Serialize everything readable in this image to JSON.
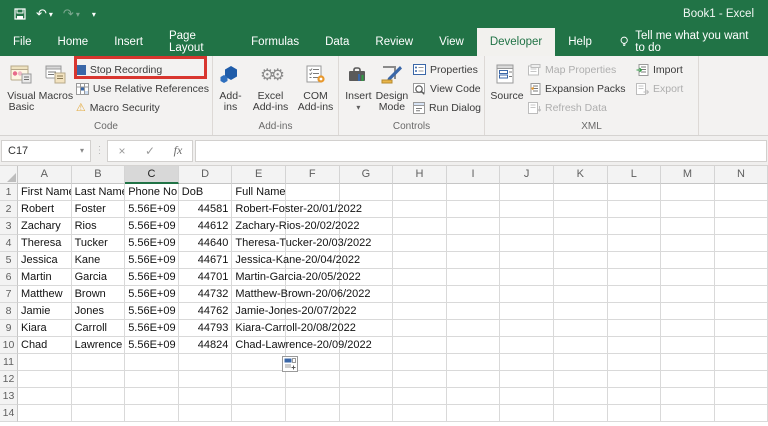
{
  "title_bar": {
    "title": "Book1 - Excel"
  },
  "glyphs": {
    "undo": "↶",
    "redo": "↷",
    "dropdown": "▾",
    "dots": "⋮",
    "close": "×",
    "check": "✓",
    "fx": "fx",
    "warning": "⚠",
    "gears": "⚙⚙",
    "gear": "⚙"
  },
  "tabs": {
    "items": [
      {
        "label": "File"
      },
      {
        "label": "Home"
      },
      {
        "label": "Insert"
      },
      {
        "label": "Page Layout"
      },
      {
        "label": "Formulas"
      },
      {
        "label": "Data"
      },
      {
        "label": "Review"
      },
      {
        "label": "View"
      },
      {
        "label": "Developer",
        "active": true
      },
      {
        "label": "Help"
      }
    ],
    "tell_me": "Tell me what you want to do"
  },
  "ribbon": {
    "code": {
      "visual_basic": "Visual Basic",
      "macros": "Macros",
      "stop_recording": "Stop Recording",
      "use_relative_references": "Use Relative References",
      "macro_security": "Macro Security",
      "label": "Code"
    },
    "addins": {
      "addins": "Add-ins",
      "excel_addins": "Excel Add-ins",
      "com_addins": "COM Add-ins",
      "label": "Add-ins"
    },
    "controls": {
      "insert": "Insert",
      "design_mode": "Design Mode",
      "properties": "Properties",
      "view_code": "View Code",
      "run_dialog": "Run Dialog",
      "label": "Controls"
    },
    "xml": {
      "source": "Source",
      "map_properties": "Map Properties",
      "expansion_packs": "Expansion Packs",
      "refresh_data": "Refresh Data",
      "import": "Import",
      "export": "Export",
      "label": "XML"
    },
    "highlight_color": "#d8362f"
  },
  "formula_bar": {
    "name_box": "C17",
    "formula": ""
  },
  "sheet": {
    "columns": [
      "A",
      "B",
      "C",
      "D",
      "E",
      "F",
      "G",
      "H",
      "I",
      "J",
      "K",
      "L",
      "M",
      "N"
    ],
    "selected_column": "C",
    "rows": 14,
    "header_row": [
      "First Name",
      "Last Name",
      "Phone No",
      "DoB",
      "Full Name"
    ],
    "records": [
      [
        "Robert",
        "Foster",
        "5.56E+09",
        "44581",
        "Robert-Foster-20/01/2022"
      ],
      [
        "Zachary",
        "Rios",
        "5.56E+09",
        "44612",
        "Zachary-Rios-20/02/2022"
      ],
      [
        "Theresa",
        "Tucker",
        "5.56E+09",
        "44640",
        "Theresa-Tucker-20/03/2022"
      ],
      [
        "Jessica",
        "Kane",
        "5.56E+09",
        "44671",
        "Jessica-Kane-20/04/2022"
      ],
      [
        "Martin",
        "Garcia",
        "5.56E+09",
        "44701",
        "Martin-Garcia-20/05/2022"
      ],
      [
        "Matthew",
        "Brown",
        "5.56E+09",
        "44732",
        "Matthew-Brown-20/06/2022"
      ],
      [
        "Jamie",
        "Jones",
        "5.56E+09",
        "44762",
        "Jamie-Jones-20/07/2022"
      ],
      [
        "Kiara",
        "Carroll",
        "5.56E+09",
        "44793",
        "Kiara-Carroll-20/08/2022"
      ],
      [
        "Chad",
        "Lawrence",
        "5.56E+09",
        "44824",
        "Chad-Lawrence-20/09/2022"
      ]
    ]
  }
}
